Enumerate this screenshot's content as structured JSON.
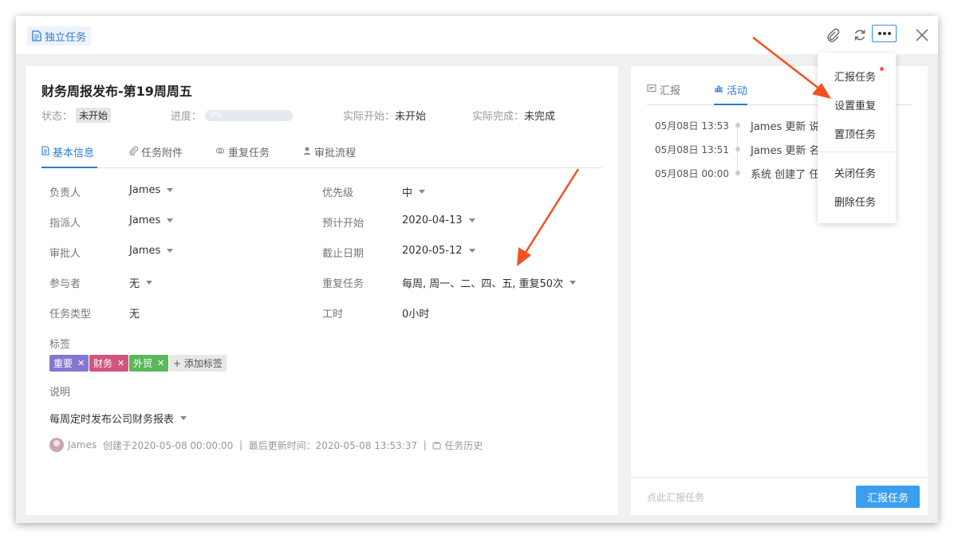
{
  "header": {
    "task_type_label": "独立任务",
    "icons": [
      "paperclip-icon",
      "refresh-icon",
      "more-icon",
      "close-icon"
    ]
  },
  "task": {
    "title": "财务周报发布-第19周周五",
    "status_label": "状态：",
    "status_value": "未开始",
    "progress_label": "进度：",
    "progress_value": "0%",
    "progress_fraction": 0,
    "actual_start_label": "实际开始：",
    "actual_start_value": "未开始",
    "actual_finish_label": "实际完成：",
    "actual_finish_value": "未完成"
  },
  "tabs": [
    {
      "label": "基本信息",
      "icon": "document-icon",
      "active": true
    },
    {
      "label": "任务附件",
      "icon": "paperclip-icon",
      "active": false
    },
    {
      "label": "重复任务",
      "icon": "repeat-icon",
      "active": false
    },
    {
      "label": "审批流程",
      "icon": "user-icon",
      "active": false
    }
  ],
  "fields": {
    "owner": {
      "label": "负责人",
      "value": "James"
    },
    "assigner": {
      "label": "指派人",
      "value": "James"
    },
    "approver": {
      "label": "审批人",
      "value": "James"
    },
    "participants": {
      "label": "参与者",
      "value": "无"
    },
    "task_type": {
      "label": "任务类型",
      "value": "无"
    },
    "priority": {
      "label": "优先级",
      "value": "中"
    },
    "planned_start": {
      "label": "预计开始",
      "value": "2020-04-13"
    },
    "deadline": {
      "label": "截止日期",
      "value": "2020-05-12"
    },
    "repeat": {
      "label": "重复任务",
      "value": "每周, 周一、二、四、五, 重复50次"
    },
    "work_hours": {
      "label": "工时",
      "value": "0小时"
    }
  },
  "labels_section": {
    "title": "标签",
    "chips": [
      {
        "text": "重要",
        "color": "#8477d1"
      },
      {
        "text": "财务",
        "color": "#d1567e"
      },
      {
        "text": "外贸",
        "color": "#5cb85c"
      }
    ],
    "add_label": "+ 添加标签"
  },
  "description_section": {
    "title": "说明",
    "value": "每周定时发布公司财务报表"
  },
  "footer": {
    "user": "James",
    "created": "创建于2020-05-08 00:00:00",
    "sep1": "|",
    "updated": "最后更新时间：2020-05-08 13:53:37",
    "sep2": "|",
    "history": "任务历史"
  },
  "activity_panel": {
    "tabs": [
      {
        "label": "汇报",
        "active": false
      },
      {
        "label": "活动",
        "active": true
      }
    ],
    "entries": [
      {
        "time": "05月08日 13:53",
        "text": "James 更新 说"
      },
      {
        "time": "05月08日 13:51",
        "text": "James 更新 名"
      },
      {
        "time": "05月08日 00:00",
        "text": "系统 创建了 任"
      }
    ],
    "input_placeholder": "点此汇报任务",
    "submit_label": "汇报任务"
  },
  "dropdown_menu": {
    "items": [
      "汇报任务",
      "设置重复",
      "置顶任务",
      "关闭任务",
      "删除任务"
    ]
  },
  "colors": {
    "accent": "#2b7cd3",
    "button": "#3a9ff0",
    "annotation_arrow": "#f4511e"
  }
}
